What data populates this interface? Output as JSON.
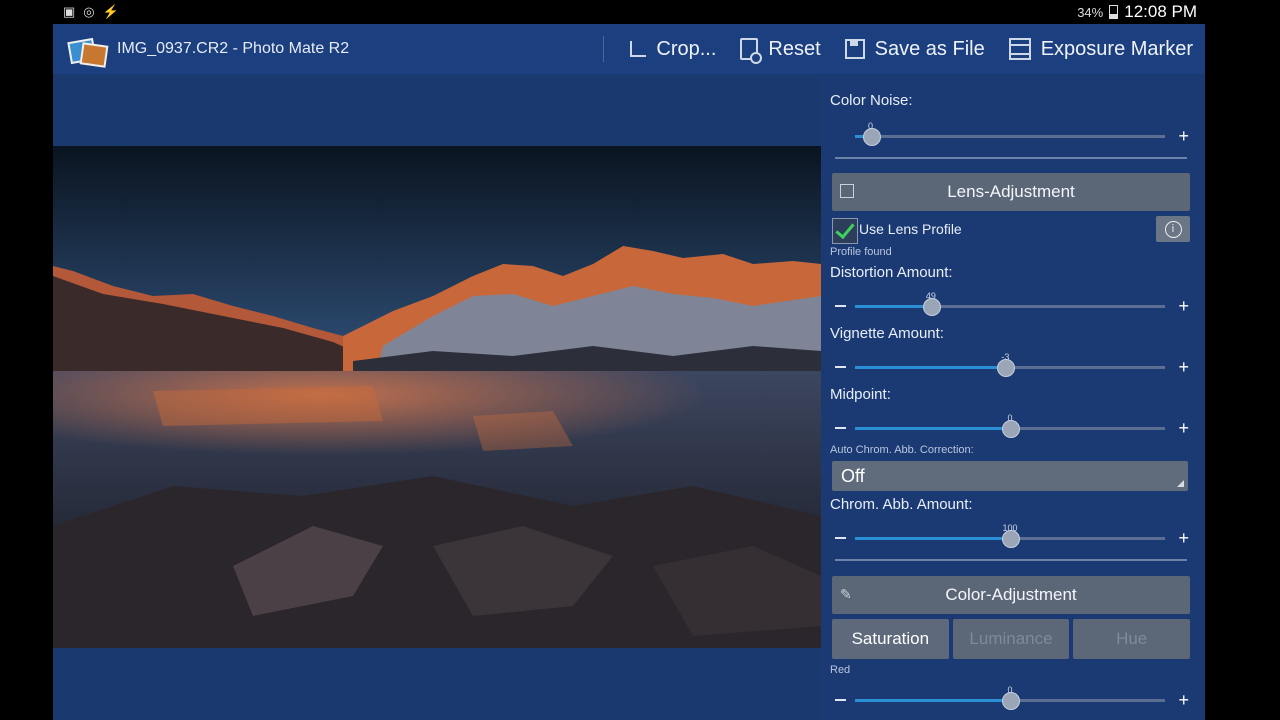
{
  "status_bar": {
    "battery": "34%",
    "time": "12:08 PM"
  },
  "action_bar": {
    "title": "IMG_0937.CR2 - Photo Mate R2",
    "actions": [
      {
        "label": "Crop...",
        "icon": "crop-icon"
      },
      {
        "label": "Reset",
        "icon": "reset-icon"
      },
      {
        "label": "Save as File",
        "icon": "save-icon"
      },
      {
        "label": "Exposure Marker",
        "icon": "exposure-marker-icon"
      }
    ]
  },
  "panel": {
    "color_noise": {
      "label": "Color Noise:",
      "value": "0",
      "fraction": 0.05
    },
    "lens_section": {
      "title": "Lens-Adjustment",
      "icon": "lens-section-icon"
    },
    "use_lens_profile": {
      "label": "Use Lens Profile",
      "checked": true,
      "status": "Profile found"
    },
    "distortion": {
      "label": "Distortion Amount:",
      "value": "49",
      "fraction": 0.245
    },
    "vignette": {
      "label": "Vignette Amount:",
      "value": "-3",
      "fraction": 0.485
    },
    "midpoint": {
      "label": "Midpoint:",
      "value": "0",
      "fraction": 0.5
    },
    "auto_chrom": {
      "label": "Auto Chrom. Abb. Correction:",
      "selected": "Off"
    },
    "chrom_amount": {
      "label": "Chrom. Abb. Amount:",
      "value": "100",
      "fraction": 0.5
    },
    "color_section": {
      "title": "Color-Adjustment",
      "icon": "color-section-icon"
    },
    "tabs": [
      "Saturation",
      "Luminance",
      "Hue"
    ],
    "active_tab": "Saturation",
    "red": {
      "label": "Red",
      "value": "0",
      "fraction": 0.5
    }
  },
  "colors": {
    "app_background": "#1b3a73",
    "action_bar": "#1c3f80",
    "slider_fill": "#2b8fd6",
    "checkbox_check": "#3ed05c"
  }
}
